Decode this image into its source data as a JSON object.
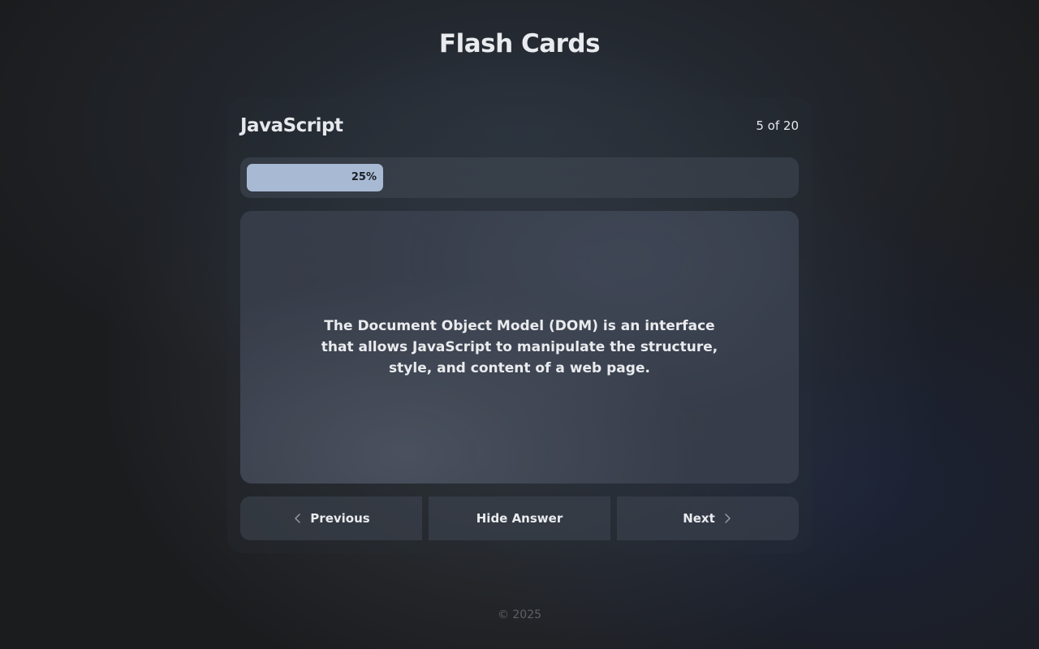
{
  "app": {
    "title": "Flash Cards"
  },
  "deck": {
    "title": "JavaScript",
    "counter": "5 of 20"
  },
  "progress": {
    "label": "25%",
    "value": 0.25
  },
  "card": {
    "text": "The Document Object Model (DOM) is an interface that allows JavaScript to manipulate the structure, style, and content of a web page."
  },
  "controls": {
    "previous_label": "Previous",
    "toggle_label": "Hide Answer",
    "next_label": "Next",
    "previous_icon": "chevron-left-icon",
    "next_icon": "chevron-right-icon"
  },
  "footer": {
    "copyright": "© 2025"
  },
  "colors": {
    "progress_fill": "#a8b9d4",
    "background": "#1b1c1e",
    "text": "#e9ebee"
  }
}
